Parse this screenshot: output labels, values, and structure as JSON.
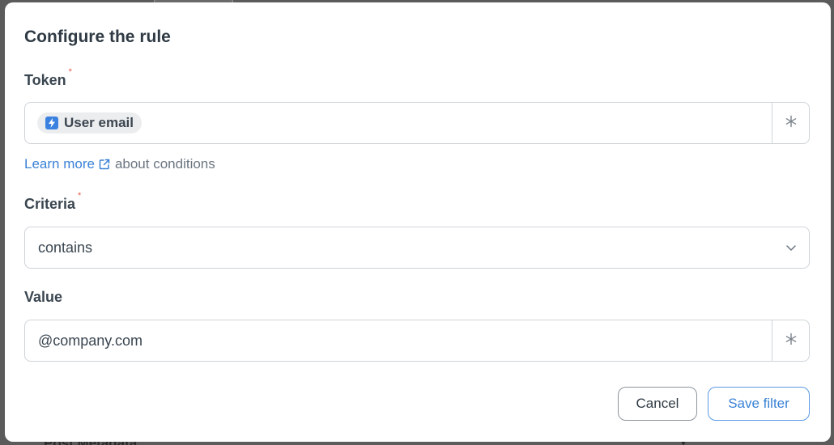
{
  "dialog": {
    "title": "Configure the rule"
  },
  "token": {
    "label": "Token",
    "required_mark": "*",
    "chip_label": "User email",
    "chip_icon": "lightning-icon",
    "addon_icon": "asterisk-icon"
  },
  "helper": {
    "link_text": "Learn more",
    "link_icon": "external-link-icon",
    "suffix_text": "about conditions"
  },
  "criteria": {
    "label": "Criteria",
    "required_mark": "*",
    "selected": "contains",
    "chevron_icon": "chevron-down-icon"
  },
  "value": {
    "label": "Value",
    "input_value": "@company.com",
    "addon_icon": "asterisk-icon"
  },
  "buttons": {
    "cancel": "Cancel",
    "save": "Save filter"
  },
  "backdrop": {
    "partial_text": "Post Metadata"
  },
  "colors": {
    "accent": "#3a82d6",
    "required": "#e25b4a",
    "border": "#cfd4d8",
    "overlay": "#5b5b5b"
  }
}
